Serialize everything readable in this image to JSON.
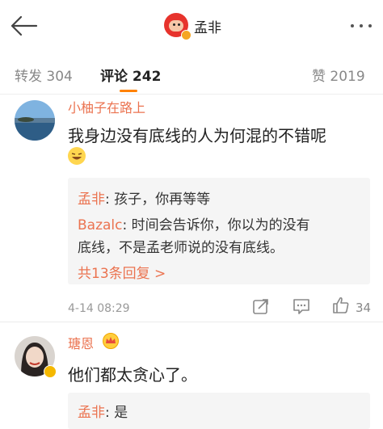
{
  "header": {
    "title": "孟非",
    "back_icon": "arrow-left-icon",
    "more_icon": "more-dots-icon"
  },
  "tabs": [
    {
      "label": "转发 304"
    },
    {
      "label": "评论 242"
    },
    {
      "label": "赞 2019"
    }
  ],
  "comments": [
    {
      "name": "小柚子在路上",
      "text": "我身边没有底线的人为何混的不错呢",
      "replies": [
        {
          "name": "孟非",
          "text": ": 孩子，你再等等"
        },
        {
          "name": "Bazalc",
          "text": ": 时间会告诉你，你以为的没有",
          "text2": "底线，不是孟老师说的没有底线。"
        }
      ],
      "more_label": "共13条回复 >",
      "time": "4-14 08:29",
      "likes": "34"
    },
    {
      "name": "瑭恩",
      "text": "他们都太贪心了。",
      "replies": [
        {
          "name": "孟非",
          "text": ": 是"
        }
      ]
    }
  ],
  "colors": {
    "accent": "#ff8200",
    "name": "#eb7350",
    "reply_bg": "#f5f5f5"
  }
}
